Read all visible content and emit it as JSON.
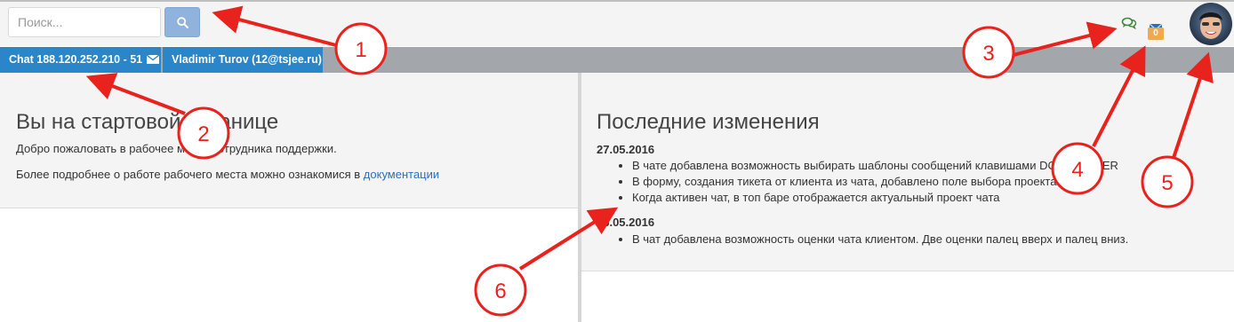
{
  "header": {
    "search_placeholder": "Поиск...",
    "mail_count": "0",
    "chat_icon": "chat-bubbles-icon",
    "mail_icon": "envelope-icon"
  },
  "tabs": [
    {
      "label": "Chat 188.120.252.210 - 51"
    },
    {
      "label": "Vladimir Turov (12@tsjee.ru)"
    }
  ],
  "left_panel": {
    "title": "Вы на стартовой странице",
    "welcome": "Добро пожаловать в рабочее место сотрудника поддержки.",
    "more_prefix": "Более подробнее о работе рабочего места можно ознакомися в ",
    "more_link": "документации"
  },
  "right_panel": {
    "title": "Последние изменения",
    "entries": [
      {
        "date": "27.05.2016",
        "items": [
          "В чате добавлена возможность выбирать шаблоны сообщений клавишами DOWN ENTER",
          "В форму, создания тикета от клиента из чата, добавлено поле выбора проекта",
          "Когда активен чат, в топ баре отображается актуальный проект чата"
        ]
      },
      {
        "date": "26.05.2016",
        "items": [
          "В чат добавлена возможность оценки чата клиентом. Две оценки палец вверх и палец вниз."
        ]
      }
    ]
  },
  "callouts": [
    "1",
    "2",
    "3",
    "4",
    "5",
    "6"
  ],
  "colors": {
    "tab_blue": "#2a86c9",
    "search_button": "#8fb3dc",
    "badge_orange": "#f0a94e",
    "callout_red": "#e8231e"
  }
}
